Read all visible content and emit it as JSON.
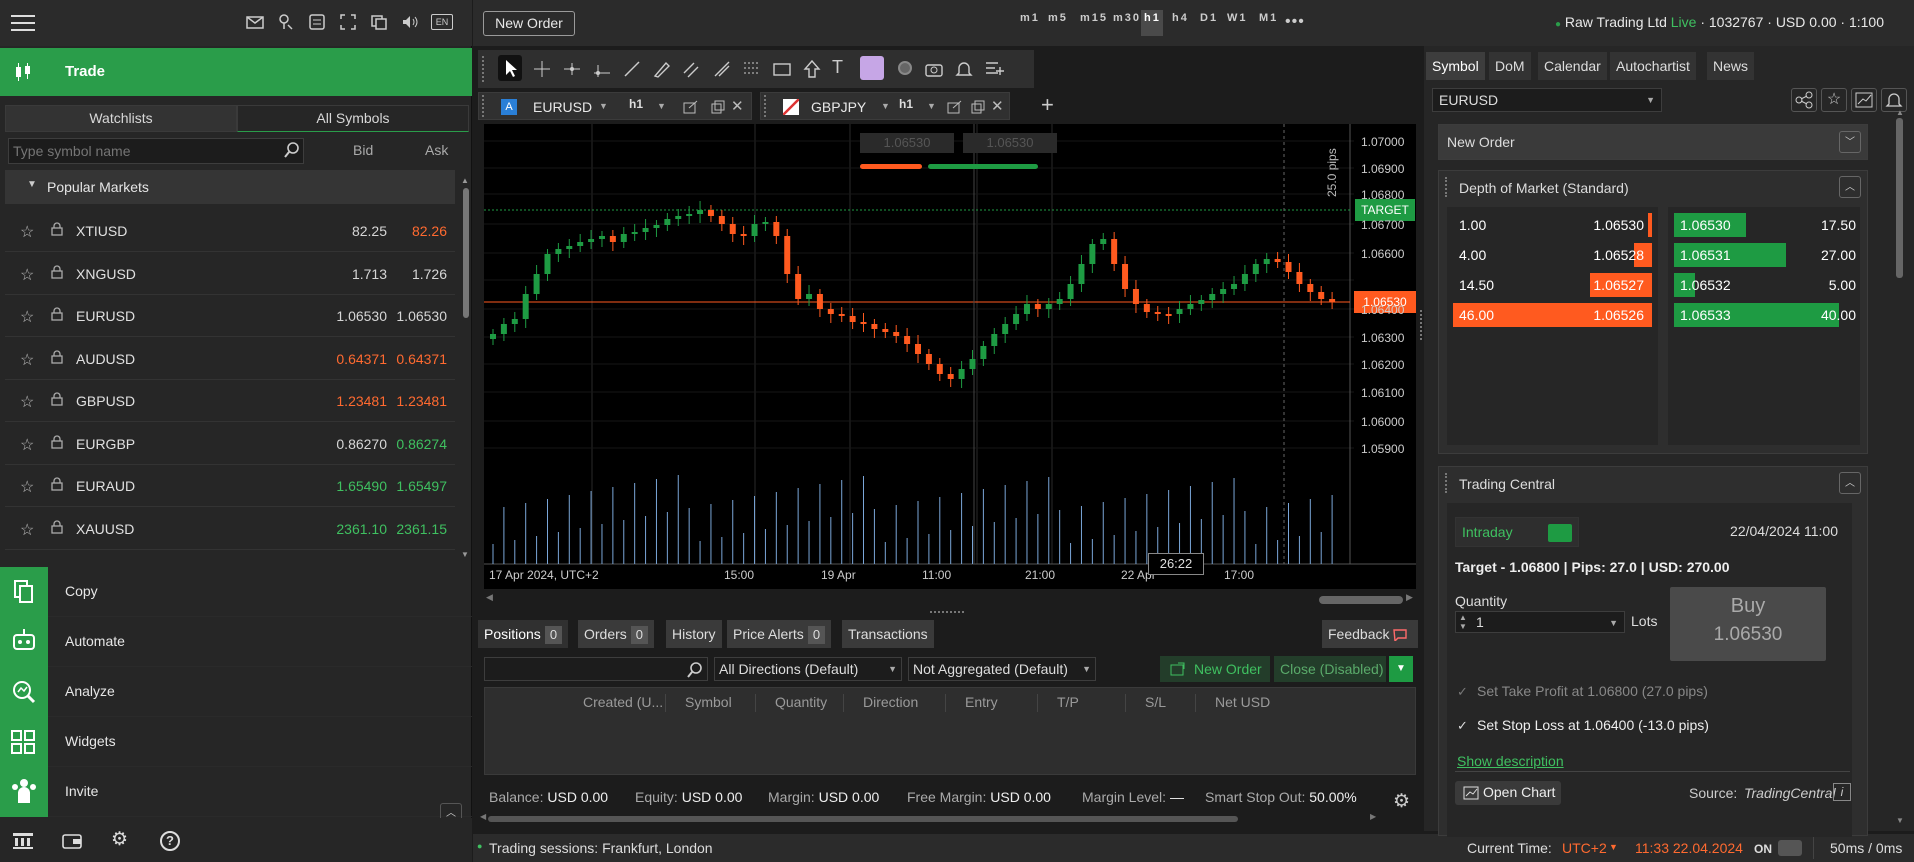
{
  "left": {
    "trade_label": "Trade",
    "tabs": [
      "Watchlists",
      "All Symbols"
    ],
    "search_placeholder": "Type symbol name",
    "col_bid": "Bid",
    "col_ask": "Ask",
    "popular": "Popular Markets",
    "rows": [
      {
        "symbol": "XTIUSD",
        "bid": "82.25",
        "ask": "82.26",
        "bid_color": "w",
        "ask_color": "r"
      },
      {
        "symbol": "XNGUSD",
        "bid": "1.713",
        "ask": "1.726",
        "bid_color": "w",
        "ask_color": "w"
      },
      {
        "symbol": "EURUSD",
        "bid": "1.06530",
        "ask": "1.06530",
        "bid_color": "w",
        "ask_color": "w"
      },
      {
        "symbol": "AUDUSD",
        "bid": "0.64371",
        "ask": "0.64371",
        "bid_color": "r",
        "ask_color": "r"
      },
      {
        "symbol": "GBPUSD",
        "bid": "1.23481",
        "ask": "1.23481",
        "bid_color": "r",
        "ask_color": "r"
      },
      {
        "symbol": "EURGBP",
        "bid": "0.86270",
        "ask": "0.86274",
        "bid_color": "w",
        "ask_color": "g"
      },
      {
        "symbol": "EURAUD",
        "bid": "1.65490",
        "ask": "1.65497",
        "bid_color": "g",
        "ask_color": "g"
      },
      {
        "symbol": "XAUUSD",
        "bid": "2361.10",
        "ask": "2361.15",
        "bid_color": "g",
        "ask_color": "g"
      }
    ],
    "menu": [
      "Copy",
      "Automate",
      "Analyze",
      "Widgets",
      "Invite"
    ]
  },
  "toolbar": {
    "new_order": "New Order",
    "timeframes": [
      "m1",
      "m5",
      "m15",
      "m30",
      "h1",
      "h4",
      "D1",
      "W1",
      "M1"
    ],
    "account": "Raw Trading Ltd",
    "live": "Live",
    "account_info": "· 1032767 · USD 0.00 · 1:100"
  },
  "chart_tabs": [
    {
      "symbol": "EURUSD",
      "tf": "h1"
    },
    {
      "symbol": "GBPJPY",
      "tf": "h1"
    }
  ],
  "chart": {
    "sell_box": "1.06530",
    "buy_box": "1.06530",
    "pips_label": "25.0 pips",
    "target_label": "TARGET",
    "current_price": "1.06530",
    "y_ticks": [
      "1.07000",
      "1.06900",
      "1.06800",
      "1.06700",
      "1.06600",
      "1.06400",
      "1.06300",
      "1.06200",
      "1.06100",
      "1.06000",
      "1.05900"
    ],
    "x_ticks": [
      "17 Apr 2024, UTC+2",
      "15:00",
      "19 Apr",
      "11:00",
      "21:00",
      "22 Apr",
      "17:00"
    ],
    "countdown": "26:22"
  },
  "bottom": {
    "tabs": [
      {
        "label": "Positions",
        "count": "0"
      },
      {
        "label": "Orders",
        "count": "0"
      },
      {
        "label": "History"
      },
      {
        "label": "Price Alerts",
        "count": "0"
      },
      {
        "label": "Transactions"
      }
    ],
    "feedback": "Feedback",
    "directions": "All Directions (Default)",
    "aggregation": "Not Aggregated (Default)",
    "new_order": "New Order",
    "close": "Close (Disabled)",
    "columns": [
      "Created (U...",
      "Symbol",
      "Quantity",
      "Direction",
      "Entry",
      "T/P",
      "S/L",
      "Net USD"
    ],
    "balance": [
      {
        "label": "Balance:",
        "value": "USD 0.00"
      },
      {
        "label": "Equity:",
        "value": "USD 0.00"
      },
      {
        "label": "Margin:",
        "value": "USD 0.00"
      },
      {
        "label": "Free Margin:",
        "value": "USD 0.00"
      },
      {
        "label": "Margin Level:",
        "value": "—"
      },
      {
        "label": "Smart Stop Out:",
        "value": "50.00%"
      }
    ]
  },
  "status": {
    "sessions": "Trading sessions: Frankfurt, London",
    "current_time_label": "Current Time:",
    "tz": "UTC+2",
    "time": "11:33 22.04.2024",
    "on": "ON",
    "latency": "50ms / 0ms"
  },
  "right": {
    "tabs": [
      "Symbol",
      "DoM",
      "Calendar",
      "Autochartist",
      "News"
    ],
    "symbol": "EURUSD",
    "new_order": "New Order",
    "dom_title": "Depth of Market (Standard)",
    "dom_bids": [
      {
        "vol": "1.00",
        "price": "1.06530",
        "fill": 0.02
      },
      {
        "vol": "4.00",
        "price": "1.06528",
        "fill": 0.09
      },
      {
        "vol": "14.50",
        "price": "1.06527",
        "fill": 0.31
      },
      {
        "vol": "46.00",
        "price": "1.06526",
        "fill": 1.0
      }
    ],
    "dom_asks": [
      {
        "price": "1.06530",
        "vol": "17.50",
        "fill": 0.38
      },
      {
        "price": "1.06531",
        "vol": "27.00",
        "fill": 0.59
      },
      {
        "price": "1.06532",
        "vol": "5.00",
        "fill": 0.11
      },
      {
        "price": "1.06533",
        "vol": "40.00",
        "fill": 0.87
      }
    ],
    "tc_title": "Trading Central",
    "tc_mode": "Intraday",
    "tc_date": "22/04/2024 11:00",
    "target": "Target - 1.06800",
    "pips": "Pips: 27.0",
    "usd": "USD: 270.00",
    "quantity_label": "Quantity",
    "quantity": "1",
    "lots": "Lots",
    "buy": "Buy",
    "buy_price": "1.06530",
    "take_profit": "Set Take Profit at 1.06800 (27.0 pips)",
    "stop_loss": "Set Stop Loss at 1.06400 (-13.0 pips)",
    "show_description": "Show description",
    "open_chart": "Open Chart",
    "source": "Source:",
    "source_name": "TradingCentral"
  }
}
